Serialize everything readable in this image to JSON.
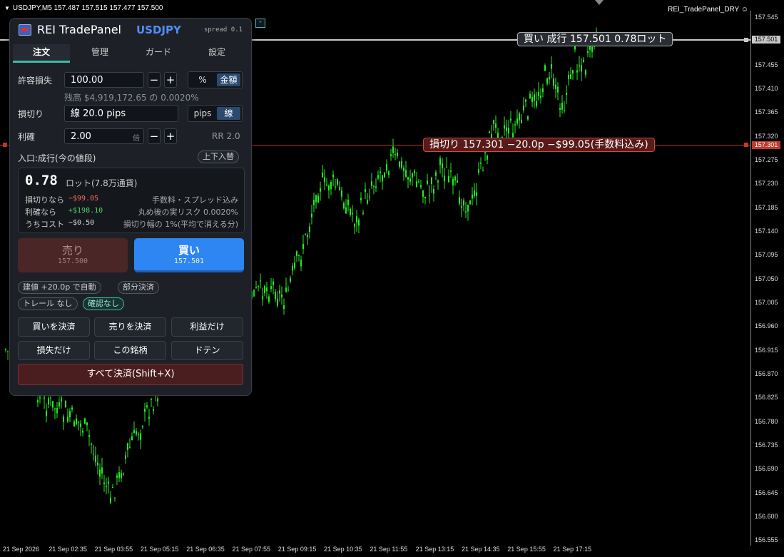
{
  "chart": {
    "header": "USDJPY,M5  157.487 157.515 157.477 157.500",
    "ea_label": "REI_TradePanel_DRY",
    "mini_button": "-",
    "buy_line_label": "買い 成行 157.501  0.78ロット",
    "sl_line_label": "損切り 157.301  −20.0p  −$99.05(手数料込み)",
    "buy_price_tag": "157.501",
    "sl_price_tag": "157.301",
    "price_axis": [
      "157.545",
      "157.455",
      "157.410",
      "157.365",
      "157.320",
      "157.275",
      "157.230",
      "157.185",
      "157.140",
      "157.095",
      "157.050",
      "157.005",
      "156.960",
      "156.915",
      "156.870",
      "156.825",
      "156.780",
      "156.735",
      "156.690",
      "156.645",
      "156.600",
      "156.555"
    ],
    "time_axis": [
      "21 Sep 2026",
      "21 Sep 02:35",
      "21 Sep 03:55",
      "21 Sep 05:15",
      "21 Sep 06:35",
      "21 Sep 07:55",
      "21 Sep 09:15",
      "21 Sep 10:35",
      "21 Sep 11:55",
      "21 Sep 13:15",
      "21 Sep 14:35",
      "21 Sep 15:55",
      "21 Sep 17:15"
    ],
    "colors": {
      "candle": "#22ee22",
      "buy_line": "#c8c8c8",
      "sl_line": "#c0392b"
    }
  },
  "panel": {
    "title": "REI TradePanel",
    "symbol": "USDJPY",
    "spread": "spread 0.1",
    "tabs": [
      "注文",
      "管理",
      "ガード",
      "設定"
    ],
    "risk": {
      "label": "許容損失",
      "value": "100.00",
      "minus": "−",
      "plus": "+",
      "mode_percent": "%",
      "mode_amount": "金額",
      "balance_note": "残高 $4,919,172.65 の 0.0020%"
    },
    "sl": {
      "label": "損切り",
      "value": "線  20.0 pips",
      "mode_pips": "pips",
      "mode_line": "線"
    },
    "tp": {
      "label": "利確",
      "value": "2.00",
      "suffix": "倍",
      "minus": "−",
      "plus": "+",
      "rr": "RR 2.0"
    },
    "entry": {
      "label": "入口:成行(今の値段)",
      "swap_button": "上下入替"
    },
    "info": {
      "lots": "0.78",
      "lots_unit": "ロット(7.8万通貨)",
      "loss_label": "損切りなら",
      "loss_value": "−$99.05",
      "loss_note": "手数料・スプレッド込み",
      "profit_label": "利確なら",
      "profit_value": "+$198.10",
      "profit_note": "丸め後の実リスク 0.0020%",
      "cost_label": "うちコスト",
      "cost_value": "−$0.50",
      "cost_note": "損切り幅の 1%(平均で消える分)"
    },
    "sell": {
      "label": "売り",
      "price": "157.500"
    },
    "buy": {
      "label": "買い",
      "price": "157.501"
    },
    "pills": [
      "建値 +20.0p で自動",
      "部分決済",
      "トレール なし",
      "確認なし"
    ],
    "actions": [
      "買いを決済",
      "売りを決済",
      "利益だけ",
      "損失だけ",
      "この銘柄",
      "ドテン"
    ],
    "close_all": "すべて決済(Shift+X)"
  }
}
